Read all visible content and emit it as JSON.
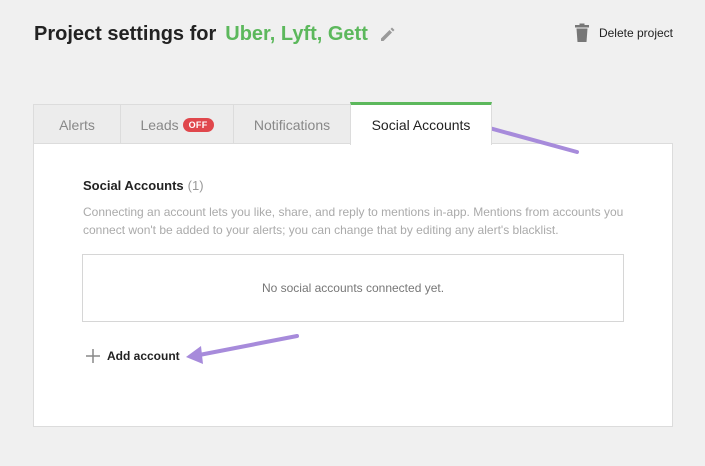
{
  "header": {
    "title_prefix": "Project settings for",
    "project_name": "Uber, Lyft, Gett",
    "delete_label": "Delete project"
  },
  "tabs": [
    {
      "label": "Alerts",
      "active": false
    },
    {
      "label": "Leads",
      "badge": "OFF",
      "active": false
    },
    {
      "label": "Notifications",
      "active": false
    },
    {
      "label": "Social Accounts",
      "active": true
    }
  ],
  "panel": {
    "section_title": "Social Accounts",
    "section_count": "(1)",
    "description": "Connecting an account lets you like, share, and reply to mentions in-app. Mentions from accounts you connect won't be added to your alerts; you can change that by editing any alert's blacklist.",
    "empty_message": "No social accounts connected yet.",
    "add_account_label": "Add account"
  },
  "colors": {
    "accent_green": "#5cb85c",
    "badge_red": "#e0474c",
    "annotation_arrow": "#a78bdb"
  },
  "icons": {
    "edit": "pencil-icon",
    "delete": "trash-icon",
    "add": "plus-icon"
  }
}
